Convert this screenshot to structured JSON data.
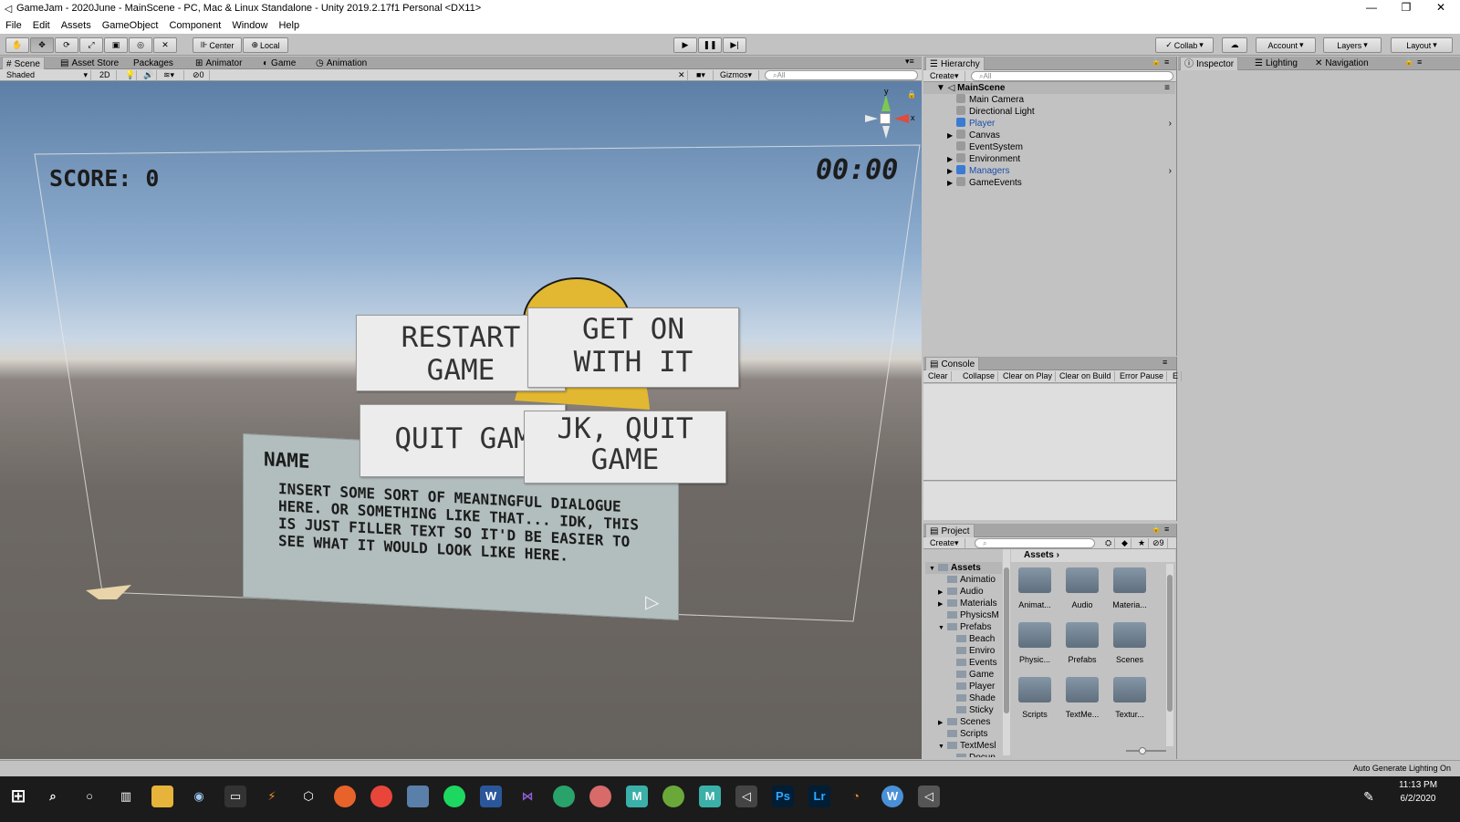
{
  "window": {
    "title": "GameJam - 2020June - MainScene - PC, Mac & Linux Standalone - Unity 2019.2.17f1 Personal <DX11>",
    "minimize": "—",
    "restore": "❐",
    "close": "✕"
  },
  "menu": [
    "File",
    "Edit",
    "Assets",
    "GameObject",
    "Component",
    "Window",
    "Help"
  ],
  "toolbar": {
    "center": "Center",
    "local": "Local",
    "collab": "Collab",
    "account": "Account",
    "layers": "Layers",
    "layout": "Layout"
  },
  "scene_tabs": [
    "Scene",
    "Asset Store",
    "Packages",
    "Animator",
    "Game",
    "Animation"
  ],
  "scene_bar": {
    "shaded": "Shaded",
    "mode_2d": "2D",
    "hidden_count": "0",
    "gizmos": "Gizmos",
    "search": "All"
  },
  "game_ui": {
    "score": "SCORE: 0",
    "timer": "00:00",
    "restart": "RESTART\nGAME",
    "get_on": "GET ON\nWITH IT",
    "quit": "QUIT GAM",
    "jk_quit": "JK, QUIT\nGAME",
    "name": "NAME",
    "dialogue": "INSERT SOME SORT OF MEANINGFUL DIALOGUE HERE. OR SOMETHING LIKE THAT... IDK, THIS IS JUST FILLER TEXT SO IT'D BE EASIER TO SEE WHAT IT WOULD LOOK LIKE HERE.",
    "gizmo_y": "y",
    "gizmo_x": "x"
  },
  "hierarchy": {
    "tab": "Hierarchy",
    "create": "Create",
    "search": "All",
    "scene": "MainScene",
    "items": [
      {
        "label": "Main Camera",
        "arrow": false,
        "blue": false
      },
      {
        "label": "Directional Light",
        "arrow": false,
        "blue": false
      },
      {
        "label": "Player",
        "arrow": false,
        "blue": true
      },
      {
        "label": "Canvas",
        "arrow": true,
        "blue": false
      },
      {
        "label": "EventSystem",
        "arrow": false,
        "blue": false
      },
      {
        "label": "Environment",
        "arrow": true,
        "blue": false
      },
      {
        "label": "Managers",
        "arrow": true,
        "blue": true
      },
      {
        "label": "GameEvents",
        "arrow": true,
        "blue": false
      }
    ]
  },
  "inspector_tabs": [
    "Inspector",
    "Lighting",
    "Navigation"
  ],
  "console": {
    "tab": "Console",
    "buttons": [
      "Clear",
      "Collapse",
      "Clear on Play",
      "Clear on Build",
      "Error Pause",
      "E"
    ]
  },
  "project": {
    "tab": "Project",
    "create": "Create",
    "hidden_count": "9",
    "assets_header": "Assets",
    "tree": [
      {
        "label": "Assets",
        "indent": 0,
        "arrow": "▼",
        "bold": true
      },
      {
        "label": "Animatio",
        "indent": 1,
        "arrow": ""
      },
      {
        "label": "Audio",
        "indent": 1,
        "arrow": "▶"
      },
      {
        "label": "Materials",
        "indent": 1,
        "arrow": "▶"
      },
      {
        "label": "PhysicsM",
        "indent": 1,
        "arrow": ""
      },
      {
        "label": "Prefabs",
        "indent": 1,
        "arrow": "▼"
      },
      {
        "label": "Beach",
        "indent": 2,
        "arrow": ""
      },
      {
        "label": "Enviro",
        "indent": 2,
        "arrow": ""
      },
      {
        "label": "Events",
        "indent": 2,
        "arrow": ""
      },
      {
        "label": "Game",
        "indent": 2,
        "arrow": ""
      },
      {
        "label": "Player",
        "indent": 2,
        "arrow": ""
      },
      {
        "label": "Shade",
        "indent": 2,
        "arrow": ""
      },
      {
        "label": "Sticky",
        "indent": 2,
        "arrow": ""
      },
      {
        "label": "Scenes",
        "indent": 1,
        "arrow": "▶"
      },
      {
        "label": "Scripts",
        "indent": 1,
        "arrow": ""
      },
      {
        "label": "TextMesl",
        "indent": 1,
        "arrow": "▼"
      },
      {
        "label": "Docun",
        "indent": 2,
        "arrow": ""
      }
    ],
    "grid": [
      "Animat...",
      "Audio",
      "Materia...",
      "Physic...",
      "Prefabs",
      "Scenes",
      "Scripts",
      "TextMe...",
      "Textur..."
    ]
  },
  "statusbar": {
    "text": "Auto Generate Lighting On"
  },
  "taskbar": {
    "time": "11:13 PM",
    "date": "6/2/2020"
  }
}
